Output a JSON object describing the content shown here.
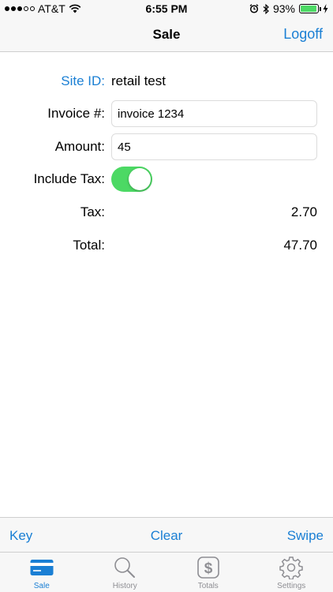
{
  "status_bar": {
    "carrier": "AT&T",
    "time": "6:55 PM",
    "battery": "93%",
    "battery_level": 0.93,
    "icons": [
      "signal-dots-icon",
      "wifi-icon",
      "alarm-icon",
      "bluetooth-icon",
      "battery-icon",
      "charging-icon"
    ]
  },
  "nav": {
    "title": "Sale",
    "right_button": "Logoff"
  },
  "form": {
    "site_id_label": "Site ID:",
    "site_id_value": "retail test",
    "invoice_label": "Invoice #:",
    "invoice_value": "invoice 1234",
    "amount_label": "Amount:",
    "amount_value": "45",
    "include_tax_label": "Include Tax:",
    "include_tax_on": true,
    "tax_label": "Tax:",
    "tax_value": "2.70",
    "total_label": "Total:",
    "total_value": "47.70"
  },
  "toolbar": {
    "key": "Key",
    "clear": "Clear",
    "swipe": "Swipe"
  },
  "tabs": [
    {
      "label": "Sale",
      "icon": "credit-card-icon",
      "active": true
    },
    {
      "label": "History",
      "icon": "magnifier-icon",
      "active": false
    },
    {
      "label": "Totals",
      "icon": "dollar-icon",
      "active": false
    },
    {
      "label": "Settings",
      "icon": "gear-icon",
      "active": false
    }
  ],
  "colors": {
    "accent": "#1a7fd4",
    "toggle_on": "#4cd964",
    "tab_inactive": "#8e8e93",
    "bar_background": "#f7f7f7"
  }
}
